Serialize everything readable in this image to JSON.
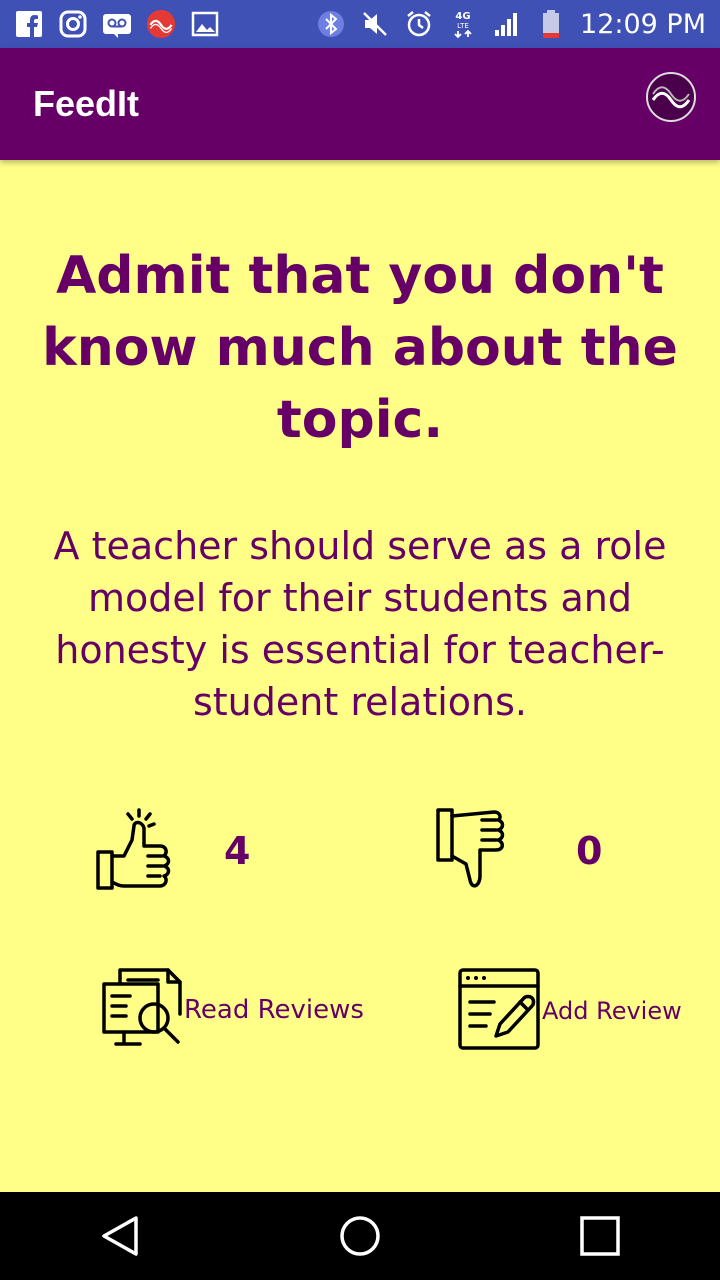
{
  "status_bar": {
    "time": "12:09 PM",
    "left_icons": [
      "facebook-icon",
      "instagram-icon",
      "voicemail-icon",
      "app-notification-icon",
      "image-icon"
    ],
    "right_icons": [
      "bluetooth-icon",
      "mute-icon",
      "alarm-icon",
      "4g-lte-icon",
      "signal-icon",
      "battery-icon"
    ],
    "network_label": "4G"
  },
  "app_bar": {
    "title": "FeedIt",
    "logo_icon": "app-logo-icon"
  },
  "card": {
    "headline": "Admit that you don't know much about the topic.",
    "description": "A teacher should serve as a role model for their students and honesty is essential for teacher-student relations."
  },
  "votes": {
    "likes": "4",
    "dislikes": "0",
    "like_icon": "thumbs-up-icon",
    "dislike_icon": "thumbs-down-icon"
  },
  "actions": {
    "read_reviews_label": "Read Reviews",
    "add_review_label": "Add Review",
    "read_icon": "document-search-icon",
    "add_icon": "edit-window-icon"
  },
  "nav": {
    "buttons": [
      "back-icon",
      "home-icon",
      "recents-icon"
    ]
  },
  "colors": {
    "primary": "#660066",
    "background": "#ffff88",
    "status_bar": "#3f51b5"
  }
}
